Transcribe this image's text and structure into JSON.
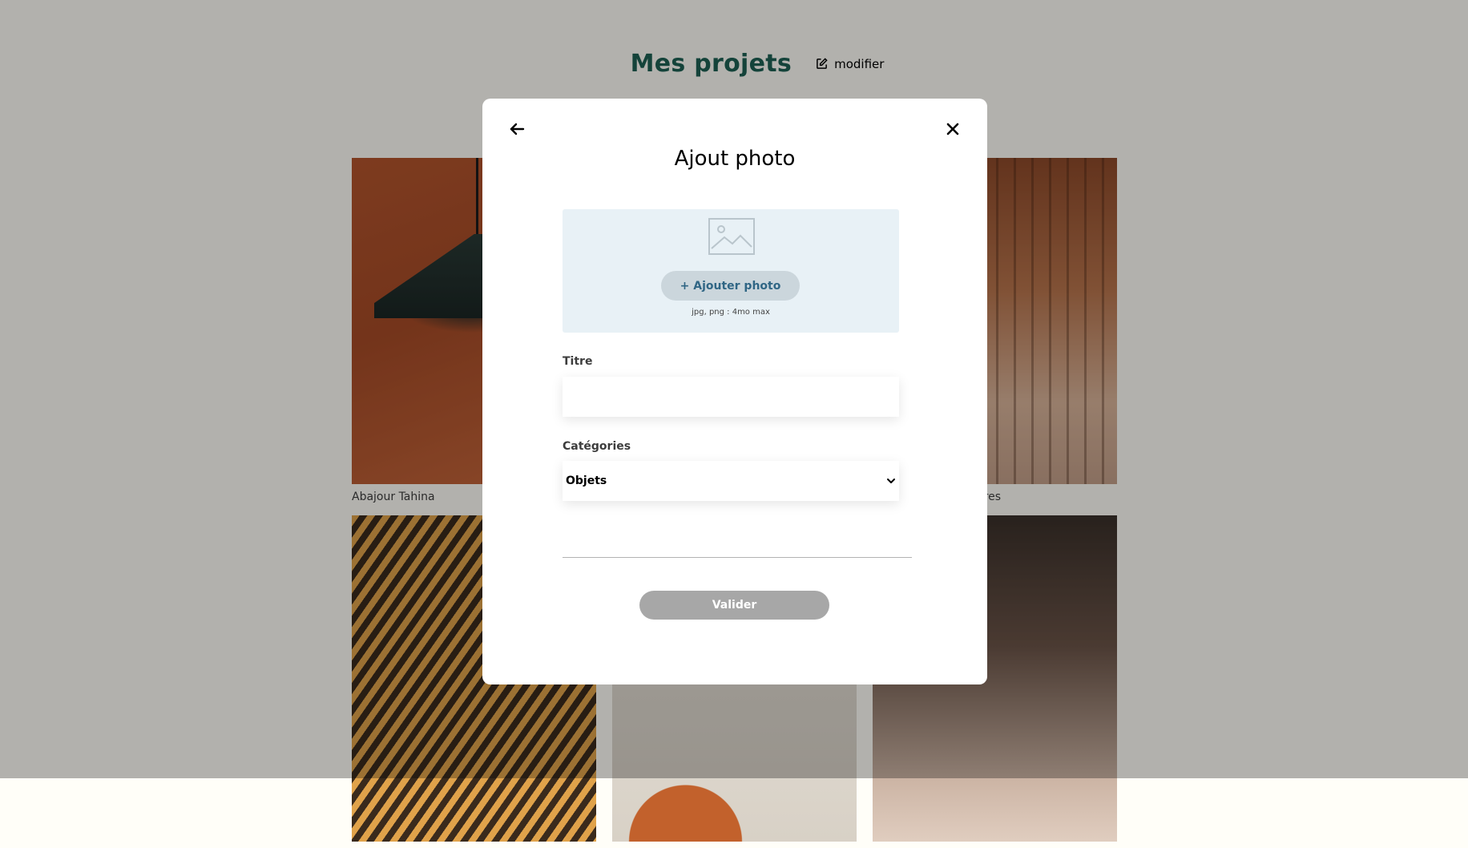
{
  "page": {
    "title": "Mes projets",
    "edit_label": "modifier",
    "gallery": [
      {
        "caption": "Abajour Tahina"
      },
      {
        "caption": ""
      },
      {
        "caption": "Londres"
      },
      {
        "caption": ""
      },
      {
        "caption": ""
      },
      {
        "caption": ""
      }
    ]
  },
  "modal": {
    "title": "Ajout photo",
    "back_icon": "arrow-left-icon",
    "close_icon": "close-icon",
    "upload": {
      "button_label": "+ Ajouter photo",
      "hint": "jpg, png : 4mo max",
      "icon": "image-placeholder-icon"
    },
    "title_field": {
      "label": "Titre",
      "value": ""
    },
    "category_field": {
      "label": "Catégories",
      "selected": "Objets"
    },
    "submit_label": "Valider"
  },
  "colors": {
    "brand_green": "#1d6154",
    "upload_bg": "#e8f1f6",
    "upload_button_bg": "#cbd6dc",
    "upload_button_text": "#306685",
    "submit_disabled": "#a7a7a7"
  }
}
